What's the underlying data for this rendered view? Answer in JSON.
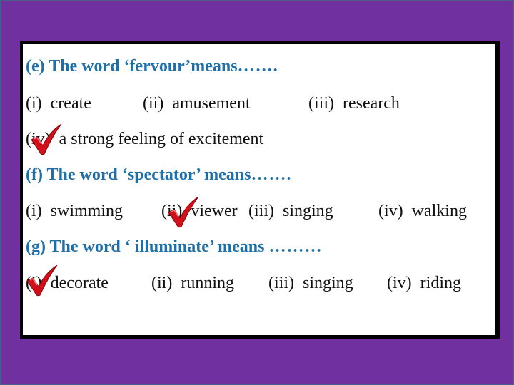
{
  "questions": [
    {
      "label": "(e) The word ‘fervour’means",
      "dots": "…….",
      "options": [
        {
          "num": "(i)",
          "text": "create"
        },
        {
          "num": "(ii)",
          "text": "amusement"
        },
        {
          "num": "(iii)",
          "text": "research"
        },
        {
          "num": "(iv)",
          "text": "a strong feeling of excitement",
          "checked": true
        }
      ]
    },
    {
      "label": "(f) The word ‘spectator’ means",
      "dots": "…….",
      "options": [
        {
          "num": "(i)",
          "text": "swimming"
        },
        {
          "num": "(ii)",
          "text": "viewer",
          "checked": true
        },
        {
          "num": "(iii)",
          "text": "singing"
        },
        {
          "num": "(iv)",
          "text": "walking"
        }
      ]
    },
    {
      "label": "(g) The word ‘ illuminate’ means",
      "dots": "………",
      "options": [
        {
          "num": "(i)",
          "text": "decorate",
          "checked": true
        },
        {
          "num": "(ii)",
          "text": "running"
        },
        {
          "num": "(iii)",
          "text": "singing"
        },
        {
          "num": "(iv)",
          "text": "riding"
        }
      ]
    }
  ],
  "colors": {
    "background": "#7030a0",
    "question_text": "#1f6fa8",
    "check_mark": "#d0101a"
  }
}
